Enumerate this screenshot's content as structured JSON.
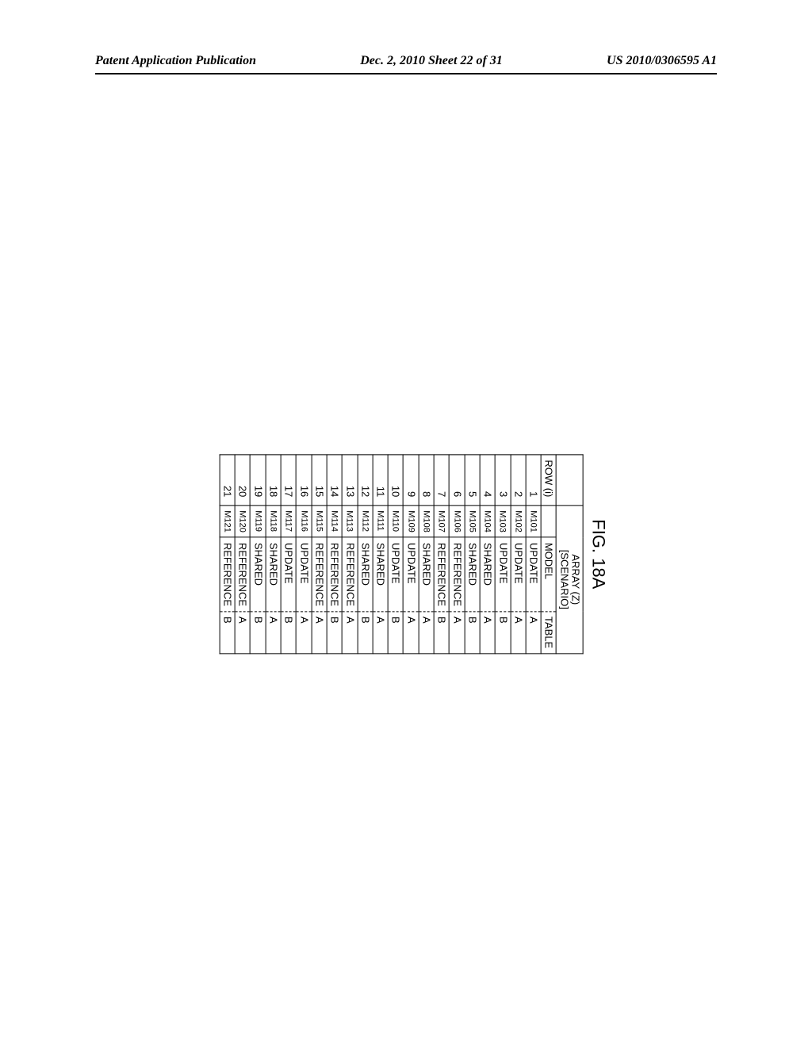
{
  "header": {
    "left": "Patent Application Publication",
    "center": "Dec. 2, 2010  Sheet 22 of 31",
    "right": "US 2010/0306595 A1"
  },
  "figure": {
    "label": "FIG. 18A",
    "scenario_title": "ARRAY (Z)\n[SCENARIO]",
    "row_header": "ROW (i)",
    "model_header": "MODEL",
    "blank_header": "",
    "table_header": "TABLE",
    "rows": [
      {
        "i": "1",
        "m": "M101",
        "model": "UPDATE",
        "table": "A"
      },
      {
        "i": "2",
        "m": "M102",
        "model": "UPDATE",
        "table": "A"
      },
      {
        "i": "3",
        "m": "M103",
        "model": "UPDATE",
        "table": "B"
      },
      {
        "i": "4",
        "m": "M104",
        "model": "SHARED",
        "table": "A"
      },
      {
        "i": "5",
        "m": "M105",
        "model": "SHARED",
        "table": "B"
      },
      {
        "i": "6",
        "m": "M106",
        "model": "REFERENCE",
        "table": "A"
      },
      {
        "i": "7",
        "m": "M107",
        "model": "REFERENCE",
        "table": "B"
      },
      {
        "i": "8",
        "m": "M108",
        "model": "SHARED",
        "table": "A"
      },
      {
        "i": "9",
        "m": "M109",
        "model": "UPDATE",
        "table": "A"
      },
      {
        "i": "10",
        "m": "M110",
        "model": "UPDATE",
        "table": "B"
      },
      {
        "i": "11",
        "m": "M111",
        "model": "SHARED",
        "table": "A"
      },
      {
        "i": "12",
        "m": "M112",
        "model": "SHARED",
        "table": "B"
      },
      {
        "i": "13",
        "m": "M113",
        "model": "REFERENCE",
        "table": "A"
      },
      {
        "i": "14",
        "m": "M114",
        "model": "REFERENCE",
        "table": "B"
      },
      {
        "i": "15",
        "m": "M115",
        "model": "REFERENCE",
        "table": "A"
      },
      {
        "i": "16",
        "m": "M116",
        "model": "UPDATE",
        "table": "A"
      },
      {
        "i": "17",
        "m": "M117",
        "model": "UPDATE",
        "table": "B"
      },
      {
        "i": "18",
        "m": "M118",
        "model": "SHARED",
        "table": "A"
      },
      {
        "i": "19",
        "m": "M119",
        "model": "SHARED",
        "table": "B"
      },
      {
        "i": "20",
        "m": "M120",
        "model": "REFERENCE",
        "table": "A"
      },
      {
        "i": "21",
        "m": "M121",
        "model": "REFERENCE",
        "table": "B"
      }
    ]
  }
}
